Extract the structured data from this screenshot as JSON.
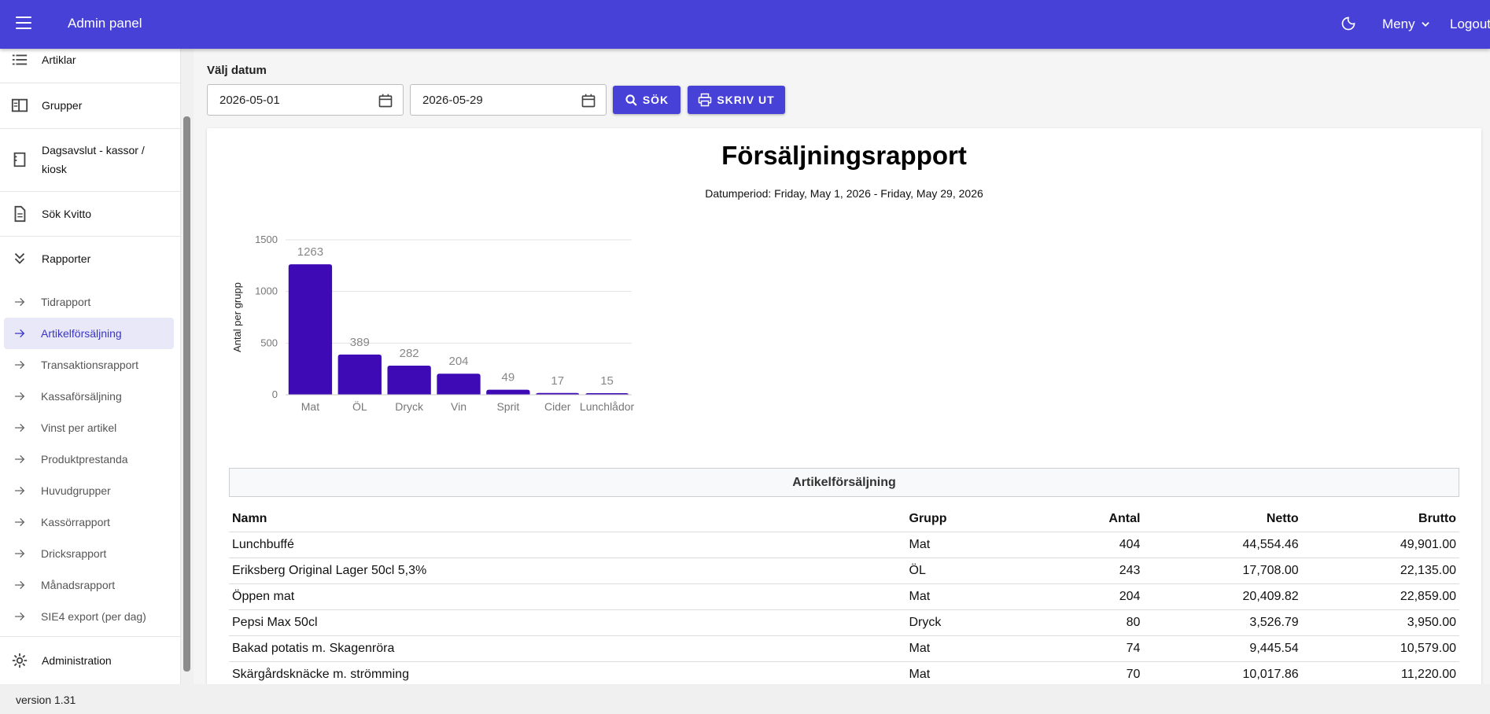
{
  "header": {
    "title": "Admin panel",
    "menu_label": "Meny",
    "logout_label": "Logout"
  },
  "sidebar": {
    "items": [
      {
        "label": "Artiklar",
        "icon": "list-icon"
      },
      {
        "label": "Grupper",
        "icon": "groups-icon"
      },
      {
        "label": "Dagsavslut - kassor /",
        "label2": "kiosk",
        "icon": "receipt-icon"
      },
      {
        "label": "Sök Kvitto",
        "icon": "document-icon"
      },
      {
        "label": "Rapporter",
        "icon": "double-chevron-icon"
      }
    ],
    "sub_items": [
      "Tidrapport",
      "Artikelförsäljning",
      "Transaktionsrapport",
      "Kassaförsäljning",
      "Vinst per artikel",
      "Produktprestanda",
      "Huvudgrupper",
      "Kassörrapport",
      "Dricksrapport",
      "Månadsrapport",
      "SIE4 export (per dag)"
    ],
    "admin_label": "Administration"
  },
  "footer": {
    "version": "version 1.31"
  },
  "filters": {
    "label": "Välj datum",
    "from_date": "2026-05-01",
    "to_date": "2026-05-29",
    "search_label": "SÖK",
    "print_label": "SKRIV UT"
  },
  "report": {
    "title": "Försäljningsrapport",
    "period": "Datumperiod: Friday, May 1, 2026 - Friday, May 29, 2026",
    "section_title": "Artikelförsäljning"
  },
  "chart_data": {
    "type": "bar",
    "categories": [
      "Mat",
      "ÖL",
      "Dryck",
      "Vin",
      "Sprit",
      "Cider",
      "Lunchlådor"
    ],
    "values": [
      1263,
      389,
      282,
      204,
      49,
      17,
      15
    ],
    "ylabel": "Antal per grupp",
    "ylim": [
      0,
      1500
    ],
    "yticks": [
      0,
      500,
      1000,
      1500
    ],
    "grid": true,
    "color": "#3d0ab5"
  },
  "table": {
    "headers": [
      "Namn",
      "Grupp",
      "Antal",
      "Netto",
      "Brutto"
    ],
    "rows": [
      [
        "Lunchbuffé",
        "Mat",
        "404",
        "44,554.46",
        "49,901.00"
      ],
      [
        "Eriksberg Original Lager 50cl 5,3%",
        "ÖL",
        "243",
        "17,708.00",
        "22,135.00"
      ],
      [
        "Öppen mat",
        "Mat",
        "204",
        "20,409.82",
        "22,859.00"
      ],
      [
        "Pepsi Max 50cl",
        "Dryck",
        "80",
        "3,526.79",
        "3,950.00"
      ],
      [
        "Bakad potatis m. Skagenröra",
        "Mat",
        "74",
        "9,445.54",
        "10,579.00"
      ],
      [
        "Skärgårdsknäcke m. strömming",
        "Mat",
        "70",
        "10,017.86",
        "11,220.00"
      ]
    ]
  },
  "colors": {
    "primary": "#4741d7",
    "bar": "#3d0ab5",
    "active_bg": "#e8e8f8"
  }
}
